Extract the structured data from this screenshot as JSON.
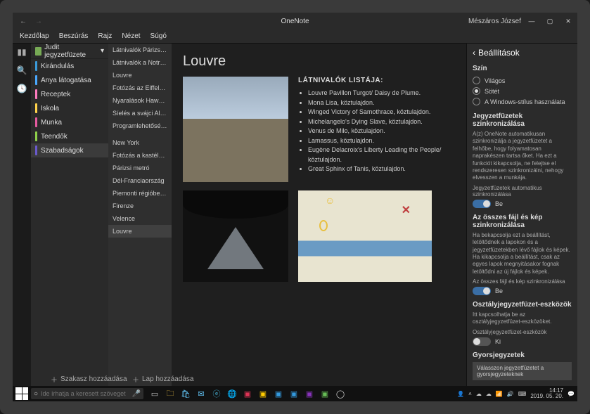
{
  "app_title": "OneNote",
  "user_name": "Mészáros József",
  "win": {
    "min": "—",
    "max": "▢",
    "close": "✕"
  },
  "ribbon": [
    "Kezdőlap",
    "Beszúrás",
    "Rajz",
    "Nézet",
    "Súgó"
  ],
  "notebook_header": "Judit jegyzetfüzete",
  "sections": [
    {
      "label": "Kirándulás",
      "color": "#3a9ad9"
    },
    {
      "label": "Anya látogatása",
      "color": "#4aa8ff"
    },
    {
      "label": "Receptek",
      "color": "#ff7bbf"
    },
    {
      "label": "Iskola",
      "color": "#ffd24a"
    },
    {
      "label": "Munka",
      "color": "#e65aa0"
    },
    {
      "label": "Teendők",
      "color": "#8fd14a"
    },
    {
      "label": "Szabadságok",
      "color": "#6a5acd",
      "selected": true
    }
  ],
  "pages": [
    "Látnivalók Párizsban",
    "Látnivalók a Notre…",
    "Louvre",
    "Fotózás az Eiffel-toron…",
    "Nyaralások Hawaii-on",
    "Síelés a svájci Alpokban",
    "Programlehetőségek P…",
    "New York",
    "Fotózás a kastélyban",
    "Párizsi metró",
    "Dél-Franciaország",
    "Piemonti régióbeli bor…",
    "Firenze",
    "Velence",
    "Louvre"
  ],
  "pages_selected_index": 14,
  "page_title": "Louvre",
  "list_heading": "LÁTNIVALÓK LISTÁJA:",
  "attractions": [
    "Louvre Pavillon Turgot/ Daisy de Plume.",
    "Mona Lisa, köztulajdon.",
    "Winged Victory of Samothrace, köztulajdon.",
    "Michelangelo's Dying Slave, köztulajdon.",
    "Venus de Milo, köztulajdon.",
    "Lamassus, köztulajdon.",
    "Eugène Delacroix's Liberty Leading the People/ köztulajdon.",
    "Great Sphinx of Tanis, köztulajdon."
  ],
  "add_section": "Szakasz hozzáadása",
  "add_page": "Lap hozzáadása",
  "settings": {
    "title": "Beállítások",
    "color_group": "Szín",
    "color_options": [
      "Világos",
      "Sötét",
      "A Windows-stílus használata"
    ],
    "color_selected_index": 1,
    "sync_title": "Jegyzetfüzetek szinkronizálása",
    "sync_desc": "A(z) OneNote automatikusan szinkronizálja a jegyzetfüzetet a felhőbe, hogy folyamatosan naprakészen tartsa őket. Ha ezt a funkciót kikapcsolja, ne felejtse el rendszeresen szinkronizálni, nehogy elvesszen a munkája.",
    "auto_sync_label": "Jegyzetfüzetek automatikus szinkronizálása",
    "auto_sync_state": "Be",
    "files_title": "Az összes fájl és kép szinkronizálása",
    "files_desc": "Ha bekapcsolja ezt a beállítást, letöltődnek a lapokon és a jegyzetfüzetekben lévő fájlok és képek. Ha kikapcsolja a beállítást, csak az egyes lapok megnyitásakor fognak letöltődni az új fájlok és képek.",
    "files_toggle_label": "Az összes fájl és kép szinkronizálása",
    "files_state": "Be",
    "class_title": "Osztályjegyzetfüzet-eszközök",
    "class_desc": "Itt kapcsolhatja be az osztályjegyzetfüzet-eszközöket.",
    "class_toggle_label": "Osztályjegyzetfüzet-eszközök",
    "class_state": "Ki",
    "quick_title": "Gyorsjegyzetek",
    "quick_select": "Válasszon jegyzetfüzetet a gyorsjegyzeteknek"
  },
  "taskbar": {
    "search_placeholder": "Ide írhatja a keresett szöveget",
    "time": "14:17",
    "date": "2019. 05. 20."
  }
}
